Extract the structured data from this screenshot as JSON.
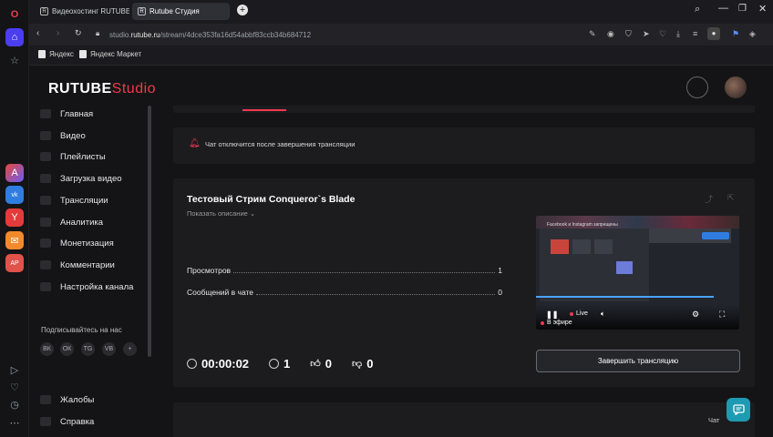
{
  "browser": {
    "tabs": [
      {
        "label": "Видеохостинг RUTUBE. С",
        "favicon": "R"
      },
      {
        "label": "Rutube Студия",
        "favicon": "R"
      }
    ],
    "address": {
      "prefix": "studio.",
      "domain": "rutube.ru",
      "path": "/stream/4dce353fa16d54abbf83ccb34b684712"
    },
    "bookmarks": [
      "Яндекс",
      "Яндекс Маркет"
    ],
    "side_icons": [
      "opera-icon",
      "home-icon",
      "star-icon",
      "aria-icon",
      "vk-icon",
      "yandex-icon",
      "mail-icon",
      "vpn-icon",
      "player-icon",
      "heart-icon",
      "clock-icon",
      "more-icon"
    ]
  },
  "studio": {
    "logo_main": "RUTUBE",
    "logo_sub": "Studio",
    "nav": [
      "Главная",
      "Видео",
      "Плейлисты",
      "Загрузка видео",
      "Трансляции",
      "Аналитика",
      "Монетизация",
      "Комментарии",
      "Настройка канала"
    ],
    "subscribe_label": "Подписывайтесь на нас",
    "socials": [
      "ВК",
      "ОК",
      "TG",
      "VB",
      "+"
    ],
    "bottom_nav": [
      "Жалобы",
      "Справка"
    ]
  },
  "notice": {
    "text": "Чат отключится после завершения трансляции"
  },
  "stream": {
    "title": "Тестовый Стрим Conqueror`s Blade",
    "show_description": "Показать описание",
    "stats": [
      {
        "label": "Просмотров",
        "value": "1"
      },
      {
        "label": "Сообщений в чате",
        "value": "0"
      }
    ],
    "timer": "00:00:02",
    "viewers": "1",
    "likes": "0",
    "dislikes": "0",
    "end_button": "Завершить трансляцию",
    "player": {
      "live_label": "Live",
      "on_air_label": "В эфире",
      "overlay_text": "Facebook и Instagram запрещены"
    }
  },
  "chat": {
    "label": "Чат"
  },
  "colors": {
    "accent": "#f0394f",
    "fab": "#1d9bb3"
  }
}
